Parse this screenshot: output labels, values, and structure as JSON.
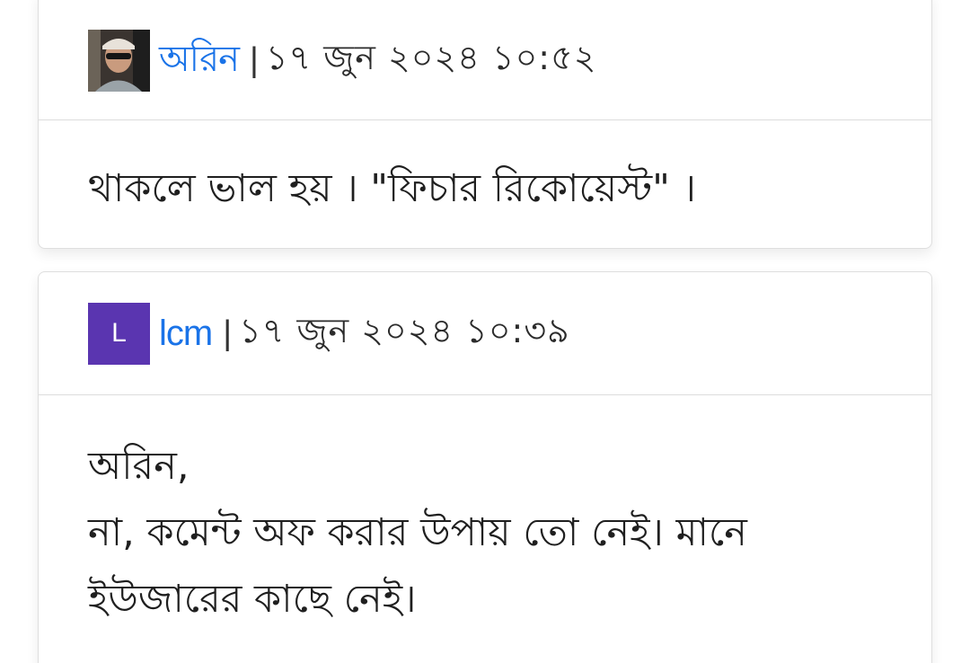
{
  "comments": [
    {
      "author": "অরিন",
      "separator": "|",
      "timestamp": "১৭ জুন ২০২৪ ১০:৫২",
      "avatar": {
        "type": "photo"
      },
      "body_lines": [
        "থাকলে ভাল হয় । \"ফিচার রিকোয়েস্ট\" ।"
      ]
    },
    {
      "author": "lcm",
      "separator": "|",
      "timestamp": "১৭ জুন ২০২৪ ১০:৩৯",
      "avatar": {
        "type": "letter",
        "letter": "L",
        "color": "#5a35b0"
      },
      "body_lines": [
        "অরিন,",
        "না, কমেন্ট অফ করার উপায় তো নেই। মানে",
        "ইউজারের কাছে নেই।"
      ]
    }
  ],
  "colors": {
    "author_link": "#1a73e8",
    "card_border": "#dedede"
  }
}
